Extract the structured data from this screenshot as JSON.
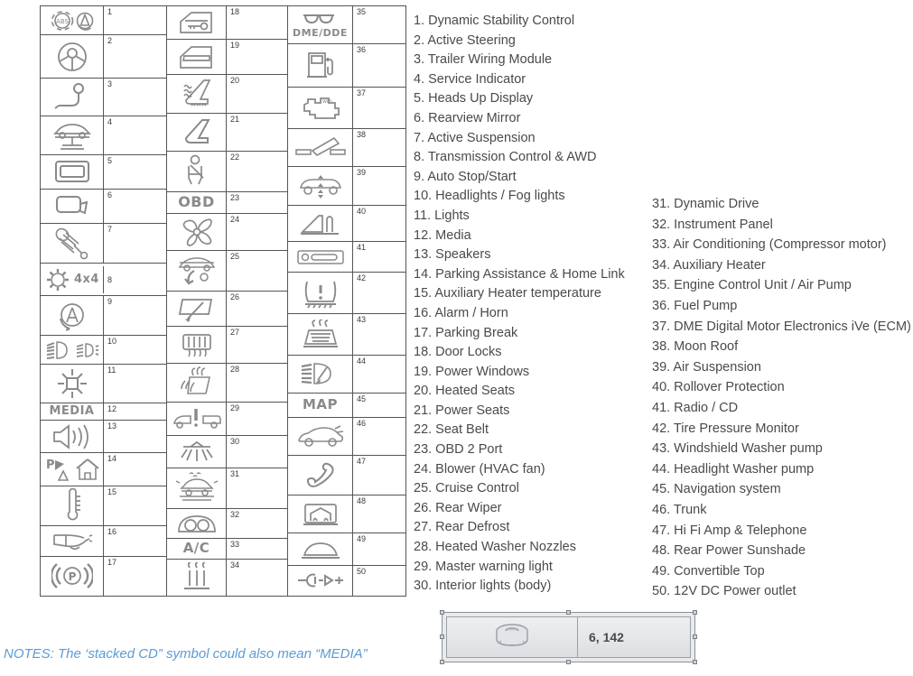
{
  "grid": {
    "columns": [
      {
        "items": [
          {
            "num": "1",
            "icon": "abs-dsc-icon"
          },
          {
            "num": "2",
            "icon": "steering-wheel-icon"
          },
          {
            "num": "3",
            "icon": "trailer-hitch-icon"
          },
          {
            "num": "4",
            "icon": "car-on-lift-icon"
          },
          {
            "num": "5",
            "icon": "heads-up-display-icon"
          },
          {
            "num": "6",
            "icon": "rearview-mirror-icon"
          },
          {
            "num": "7",
            "icon": "shock-absorber-icon"
          },
          {
            "num": "8",
            "icon": "gear-4x4-icon",
            "text": "4x4"
          },
          {
            "num": "9",
            "icon": "auto-start-stop-icon"
          },
          {
            "num": "10",
            "icon": "headlight-foglight-icon"
          },
          {
            "num": "11",
            "icon": "sun-lights-icon"
          },
          {
            "num": "12",
            "icon": "media-text-icon",
            "text": "MEDIA"
          },
          {
            "num": "13",
            "icon": "speaker-icon"
          },
          {
            "num": "14",
            "icon": "park-distance-home-link-icon"
          },
          {
            "num": "15",
            "icon": "thermometer-icon"
          },
          {
            "num": "16",
            "icon": "horn-icon"
          },
          {
            "num": "17",
            "icon": "parking-brake-icon"
          }
        ]
      },
      {
        "items": [
          {
            "num": "18",
            "icon": "door-lock-icon"
          },
          {
            "num": "19",
            "icon": "power-window-icon"
          },
          {
            "num": "20",
            "icon": "heated-seat-icon"
          },
          {
            "num": "21",
            "icon": "power-seat-icon"
          },
          {
            "num": "22",
            "icon": "seat-belt-icon"
          },
          {
            "num": "23",
            "icon": "obd-text-icon",
            "text": "OBD"
          },
          {
            "num": "24",
            "icon": "blower-fan-icon"
          },
          {
            "num": "25",
            "icon": "cruise-control-icon"
          },
          {
            "num": "26",
            "icon": "rear-wiper-icon"
          },
          {
            "num": "27",
            "icon": "rear-defrost-icon"
          },
          {
            "num": "28",
            "icon": "heated-washer-nozzle-icon"
          },
          {
            "num": "29",
            "icon": "master-warning-light-icon"
          },
          {
            "num": "30",
            "icon": "interior-light-icon"
          },
          {
            "num": "31",
            "icon": "dynamic-drive-icon"
          },
          {
            "num": "32",
            "icon": "instrument-panel-icon"
          },
          {
            "num": "33",
            "icon": "ac-text-icon",
            "text": "A/C"
          },
          {
            "num": "34",
            "icon": "auxiliary-heater-icon"
          }
        ]
      },
      {
        "items": [
          {
            "num": "35",
            "icon": "dme-dde-icon",
            "text": "DME/DDE"
          },
          {
            "num": "36",
            "icon": "fuel-pump-icon"
          },
          {
            "num": "37",
            "icon": "check-engine-icon"
          },
          {
            "num": "38",
            "icon": "moon-roof-icon"
          },
          {
            "num": "39",
            "icon": "air-suspension-icon"
          },
          {
            "num": "40",
            "icon": "rollover-protection-icon"
          },
          {
            "num": "41",
            "icon": "radio-cd-icon"
          },
          {
            "num": "42",
            "icon": "tire-pressure-icon"
          },
          {
            "num": "43",
            "icon": "windshield-washer-icon"
          },
          {
            "num": "44",
            "icon": "headlight-washer-icon"
          },
          {
            "num": "45",
            "icon": "map-text-icon",
            "text": "MAP"
          },
          {
            "num": "46",
            "icon": "trunk-icon"
          },
          {
            "num": "47",
            "icon": "telephone-icon"
          },
          {
            "num": "48",
            "icon": "rear-sunshade-icon"
          },
          {
            "num": "49",
            "icon": "convertible-top-icon"
          },
          {
            "num": "50",
            "icon": "power-outlet-icon"
          }
        ]
      }
    ]
  },
  "legend": {
    "column1": [
      "1. Dynamic Stability Control",
      "2. Active Steering",
      "3. Trailer Wiring Module",
      "4. Service Indicator",
      "5. Heads Up Display",
      "6. Rearview Mirror",
      "7. Active Suspension",
      "8. Transmission Control & AWD",
      "9. Auto Stop/Start",
      "10. Headlights / Fog lights",
      "11. Lights",
      "12. Media",
      "13. Speakers",
      "14. Parking Assistance & Home Link",
      "15. Auxiliary Heater temperature",
      "16. Alarm / Horn",
      "17. Parking Break",
      "18. Door Locks",
      "19. Power Windows",
      "20. Heated Seats",
      "21. Power Seats",
      "22. Seat Belt",
      "23. OBD 2 Port",
      "24. Blower (HVAC fan)",
      "25. Cruise Control",
      "26. Rear Wiper",
      "27. Rear Defrost",
      "28. Heated Washer Nozzles",
      "29. Master warning light",
      "30. Interior lights (body)"
    ],
    "column2": [
      "31. Dynamic Drive",
      "32. Instrument Panel",
      "33. Air Conditioning (Compressor motor)",
      "34. Auxiliary Heater",
      "35. Engine Control Unit / Air Pump",
      "36. Fuel Pump",
      "37. DME Digital Motor Electronics iVe (ECM)",
      "38. Moon Roof",
      "39. Air Suspension",
      "40. Rollover Protection",
      "41. Radio / CD",
      "42. Tire Pressure Monitor",
      "43. Windshield Washer pump",
      "44. Headlight Washer pump",
      "45. Navigation system",
      "46. Trunk",
      "47. Hi Fi Amp & Telephone",
      "48. Rear Power Sunshade",
      "49. Convertible Top",
      "50. 12V DC Power outlet"
    ]
  },
  "notes": "NOTES: The ‘stacked CD” symbol could also mean “MEDIA”",
  "photo_inset": {
    "code": "6, 142",
    "symbol": "stacked-cd-icon"
  },
  "colors": {
    "note_blue": "#5b9bd5",
    "grid_line": "#555555",
    "icon_gray": "#8a8a8a",
    "text_gray": "#4a4a4a"
  }
}
